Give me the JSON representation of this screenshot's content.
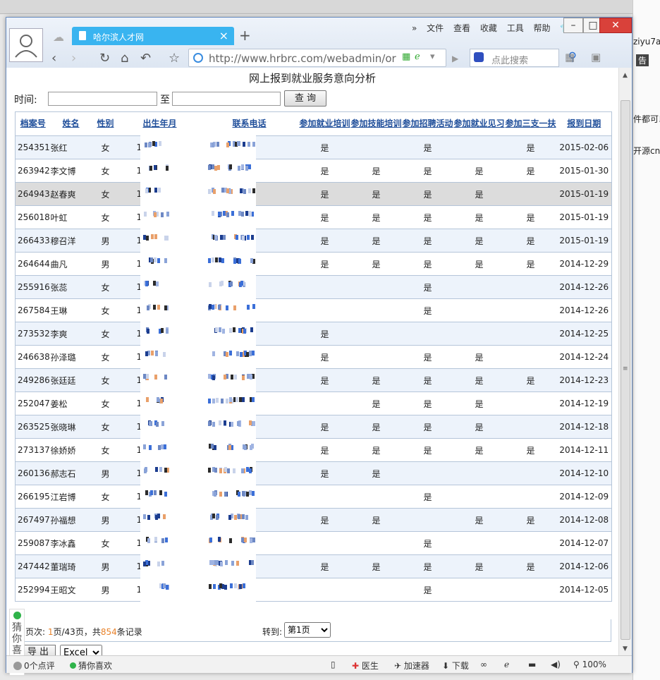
{
  "browser": {
    "tab_title": "哈尔滨人才网",
    "url": "http://www.hrbrc.com/webadmin/or",
    "search_placeholder": "点此搜索",
    "menu": [
      "文件",
      "查看",
      "收藏",
      "工具",
      "帮助"
    ],
    "menu_more": "»",
    "zoom": "100%",
    "status_left": [
      "0个点评",
      "猜你喜欢"
    ],
    "status_right": [
      "医生",
      "加速器",
      "下载"
    ],
    "guess_like": [
      "猜",
      "你",
      "喜",
      "欢"
    ]
  },
  "desktop_right": {
    "text1": "ziyu7a",
    "text2": "告",
    "text3": "件都可以",
    "text4": "开源cn"
  },
  "page": {
    "title": "网上报到就业服务意向分析",
    "time_label": "时间:",
    "to_label": "至",
    "query_button": "查 询",
    "export_button": "导 出",
    "export_format": "Excel",
    "pager_text_pre": "页次: ",
    "pager_cur": "1",
    "pager_text_mid": "页/43页，共",
    "pager_total": "854",
    "pager_text_post": "条记录",
    "goto_label": "转到:",
    "goto_option": "第1页"
  },
  "table": {
    "headers": [
      "档案号",
      "姓名",
      "性别",
      "出生年月",
      "联系电话",
      "参加就业培训",
      "参加技能培训",
      "参加招聘活动",
      "参加就业见习",
      "参加三支一扶",
      "报到日期"
    ],
    "rows": [
      {
        "id": "254351",
        "name": "张红",
        "sex": "女",
        "birth": "199",
        "phone": "9",
        "c1": "是",
        "c2": "",
        "c3": "是",
        "c4": "",
        "c5": "是",
        "date": "2015-02-06"
      },
      {
        "id": "263942",
        "name": "李文博",
        "sex": "女",
        "birth": "199",
        "phone": "26",
        "c1": "是",
        "c2": "是",
        "c3": "是",
        "c4": "是",
        "c5": "是",
        "date": "2015-01-30"
      },
      {
        "id": "264943",
        "name": "赵春爽",
        "sex": "女",
        "birth": "199",
        "phone": "51",
        "c1": "是",
        "c2": "是",
        "c3": "是",
        "c4": "是",
        "c5": "",
        "date": "2015-01-19"
      },
      {
        "id": "256018",
        "name": "叶虹",
        "sex": "女",
        "birth": "199",
        "phone": "36",
        "c1": "是",
        "c2": "是",
        "c3": "是",
        "c4": "是",
        "c5": "是",
        "date": "2015-01-19"
      },
      {
        "id": "266433",
        "name": "穆召洋",
        "sex": "男",
        "birth": "199",
        "phone": "08",
        "c1": "是",
        "c2": "是",
        "c3": "是",
        "c4": "是",
        "c5": "是",
        "date": "2015-01-19"
      },
      {
        "id": "264644",
        "name": "曲凡",
        "sex": "男",
        "birth": "199",
        "phone": "63",
        "c1": "是",
        "c2": "是",
        "c3": "是",
        "c4": "是",
        "c5": "是",
        "date": "2014-12-29"
      },
      {
        "id": "255916",
        "name": "张蕊",
        "sex": "女",
        "birth": "199",
        "phone": "66",
        "c1": "",
        "c2": "",
        "c3": "是",
        "c4": "",
        "c5": "",
        "date": "2014-12-26"
      },
      {
        "id": "267584",
        "name": "王琳",
        "sex": "女",
        "birth": "199",
        "phone": "16",
        "c1": "",
        "c2": "",
        "c3": "是",
        "c4": "",
        "c5": "",
        "date": "2014-12-26"
      },
      {
        "id": "273532",
        "name": "李爽",
        "sex": "女",
        "birth": "199",
        "phone": "17945014",
        "c1": "是",
        "c2": "",
        "c3": "",
        "c4": "",
        "c5": "",
        "date": "2014-12-25"
      },
      {
        "id": "246638",
        "name": "孙泽璐",
        "sex": "女",
        "birth": "199",
        "phone": "07",
        "c1": "是",
        "c2": "",
        "c3": "是",
        "c4": "是",
        "c5": "",
        "date": "2014-12-24"
      },
      {
        "id": "249286",
        "name": "张廷廷",
        "sex": "女",
        "birth": "199",
        "phone": "68",
        "c1": "是",
        "c2": "是",
        "c3": "是",
        "c4": "是",
        "c5": "是",
        "date": "2014-12-23"
      },
      {
        "id": "252047",
        "name": "姜松",
        "sex": "女",
        "birth": "198",
        "phone": "15",
        "c1": "",
        "c2": "是",
        "c3": "是",
        "c4": "是",
        "c5": "",
        "date": "2014-12-19"
      },
      {
        "id": "263525",
        "name": "张晓琳",
        "sex": "女",
        "birth": "199",
        "phone": "29",
        "c1": "是",
        "c2": "是",
        "c3": "是",
        "c4": "是",
        "c5": "",
        "date": "2014-12-18"
      },
      {
        "id": "273137",
        "name": "徐娇娇",
        "sex": "女",
        "birth": "198",
        "phone": "63",
        "c1": "是",
        "c2": "是",
        "c3": "是",
        "c4": "是",
        "c5": "是",
        "date": "2014-12-11"
      },
      {
        "id": "260136",
        "name": "郝志石",
        "sex": "男",
        "birth": "199",
        "phone": "51",
        "c1": "是",
        "c2": "是",
        "c3": "",
        "c4": "",
        "c5": "",
        "date": "2014-12-10"
      },
      {
        "id": "266195",
        "name": "江岩博",
        "sex": "女",
        "birth": "199",
        "phone": "39",
        "c1": "",
        "c2": "",
        "c3": "是",
        "c4": "",
        "c5": "",
        "date": "2014-12-09"
      },
      {
        "id": "267497",
        "name": "孙福想",
        "sex": "男",
        "birth": "199",
        "phone": "77",
        "c1": "是",
        "c2": "是",
        "c3": "",
        "c4": "是",
        "c5": "是",
        "date": "2014-12-08"
      },
      {
        "id": "259087",
        "name": "李冰鑫",
        "sex": "女",
        "birth": "198",
        "phone": "10",
        "c1": "",
        "c2": "",
        "c3": "是",
        "c4": "",
        "c5": "",
        "date": "2014-12-07"
      },
      {
        "id": "247442",
        "name": "董瑞琦",
        "sex": "男",
        "birth": "199",
        "phone": "14",
        "c1": "是",
        "c2": "是",
        "c3": "是",
        "c4": "是",
        "c5": "是",
        "date": "2014-12-06"
      },
      {
        "id": "252994",
        "name": "王昭文",
        "sex": "男",
        "birth": "199",
        "phone": "58",
        "c1": "",
        "c2": "",
        "c3": "是",
        "c4": "",
        "c5": "",
        "date": "2014-12-05"
      }
    ]
  },
  "colors": {
    "link": "#1f4e9a",
    "row_alt": "#edf3fb",
    "tab": "#39b4f0",
    "highlight": "#dcdcdc",
    "count": "#e8822a"
  }
}
